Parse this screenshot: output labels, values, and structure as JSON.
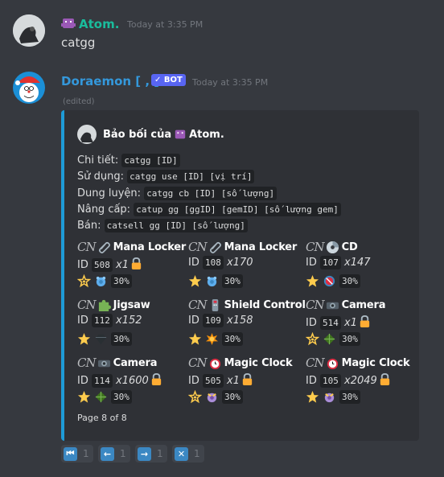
{
  "messages": [
    {
      "username": "Atom.",
      "timestamp": "Today at 3:35 PM",
      "content": "catgg",
      "username_color": "#1abc9c"
    },
    {
      "username": "Doraemon [ , ]",
      "bot_badge": "✓ BOT",
      "timestamp": "Today at 3:35 PM",
      "edited": "(edited)",
      "username_color": "#3498db"
    }
  ],
  "embed": {
    "author_prefix": "Bảo bối của",
    "author_name": "Atom.",
    "color": "#1e9bd7",
    "lines": [
      {
        "label": "Chi tiết:",
        "code": "catgg [ID]"
      },
      {
        "label": "Sử dụng:",
        "code": "catgg use [ID] [vị trí]"
      },
      {
        "label": "Dung luyện:",
        "code": "catgg cb [ID] [số lượng]"
      },
      {
        "label": "Nâng cấp:",
        "code": "catup gg [ggID] [gemID] [số lượng gem]"
      },
      {
        "label": "Bán:",
        "code": "catsell gg [ID] [số lượng]"
      }
    ],
    "id_label": "ID",
    "items": [
      {
        "name": "Mana Locker",
        "icon": "paperclip-icon",
        "id": "508",
        "qty": "x1",
        "locked": true,
        "star": "sparkle-star",
        "gem": "blue-gem",
        "pct": "30%"
      },
      {
        "name": "Mana Locker",
        "icon": "paperclip-icon",
        "id": "108",
        "qty": "x170",
        "locked": false,
        "star": "star",
        "gem": "blue-gem",
        "pct": "30%"
      },
      {
        "name": "CD",
        "icon": "disc-icon",
        "id": "107",
        "qty": "x147",
        "locked": false,
        "star": "star",
        "gem": "red-gem",
        "pct": "30%"
      },
      {
        "name": "Jigsaw",
        "icon": "puzzle-icon",
        "id": "112",
        "qty": "x152",
        "locked": false,
        "star": "star",
        "gem": "black-gem",
        "pct": "30%"
      },
      {
        "name": "Shield Control",
        "icon": "remote-icon",
        "id": "109",
        "qty": "x158",
        "locked": false,
        "star": "star",
        "gem": "orange-gem",
        "pct": "30%"
      },
      {
        "name": "Camera",
        "icon": "camera-icon",
        "id": "514",
        "qty": "x1",
        "locked": true,
        "star": "sparkle-star",
        "gem": "green-gem",
        "pct": "30%"
      },
      {
        "name": "Camera",
        "icon": "camera-icon",
        "id": "114",
        "qty": "x1600",
        "locked": true,
        "star": "star",
        "gem": "green-gem",
        "pct": "30%"
      },
      {
        "name": "Magic Clock",
        "icon": "clock-icon",
        "id": "505",
        "qty": "x1",
        "locked": true,
        "star": "sparkle-star",
        "gem": "purple-gem",
        "pct": "30%"
      },
      {
        "name": "Magic Clock",
        "icon": "clock-icon",
        "id": "105",
        "qty": "x2049",
        "locked": true,
        "star": "star",
        "gem": "purple-gem",
        "pct": "30%"
      }
    ],
    "footer": "Page 8 of 8"
  },
  "buttons": [
    {
      "icon": "first-page-icon",
      "glyph": "⏮",
      "count": "1"
    },
    {
      "icon": "previous-icon",
      "glyph": "←",
      "count": "1"
    },
    {
      "icon": "next-icon",
      "glyph": "→",
      "count": "1"
    },
    {
      "icon": "close-icon",
      "glyph": "✕",
      "count": "1"
    }
  ]
}
